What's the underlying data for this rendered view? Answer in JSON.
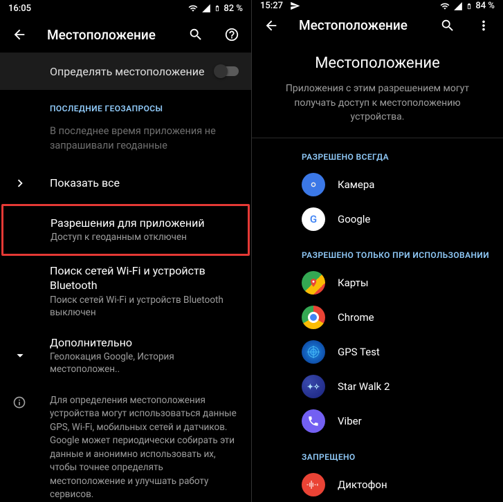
{
  "left": {
    "status_time": "16:05",
    "battery": "82 %",
    "title": "Местоположение",
    "toggle_label": "Определять местоположение",
    "section_recent": "ПОСЛЕДНИЕ ГЕОЗАПРОСЫ",
    "no_recent": "В последнее время приложения не запрашивали геоданные",
    "show_all": "Показать все",
    "perm_title": "Разрешения для приложений",
    "perm_sub": "Доступ к геоданным отключен",
    "scan_title": "Поиск сетей Wi-Fi и устройств Bluetooth",
    "scan_sub": "Поиск сетей Wi-Fi и устройств Bluetooth выключен",
    "adv_title": "Дополнительно",
    "adv_sub": "Геолокация Google, История местоположен..",
    "footer": "Для определения местоположения устройства могут использоваться данные GPS, Wi-Fi, мобильных сетей и датчиков. Google может периодически собирать эти данные и анонимно использовать их, чтобы точнее определять местоположение и улучшать работу сервисов."
  },
  "right": {
    "status_time": "15:27",
    "battery": "84 %",
    "title": "Местоположение",
    "big_title": "Местоположение",
    "big_sub": "Приложения с этим разрешением могут получать доступ к местоположению устройства.",
    "section_always": "РАЗРЕШЕНО ВСЕГДА",
    "section_foreground": "РАЗРЕШЕНО ТОЛЬКО ПРИ ИСПОЛЬЗОВАНИИ",
    "section_denied": "ЗАПРЕЩЕНО",
    "apps_always": [
      {
        "name": "Камера"
      },
      {
        "name": "Google"
      }
    ],
    "apps_fg": [
      {
        "name": "Карты"
      },
      {
        "name": "Chrome"
      },
      {
        "name": "GPS Test"
      },
      {
        "name": "Star Walk 2"
      },
      {
        "name": "Viber"
      }
    ],
    "apps_denied": [
      {
        "name": "Диктофон"
      }
    ]
  }
}
